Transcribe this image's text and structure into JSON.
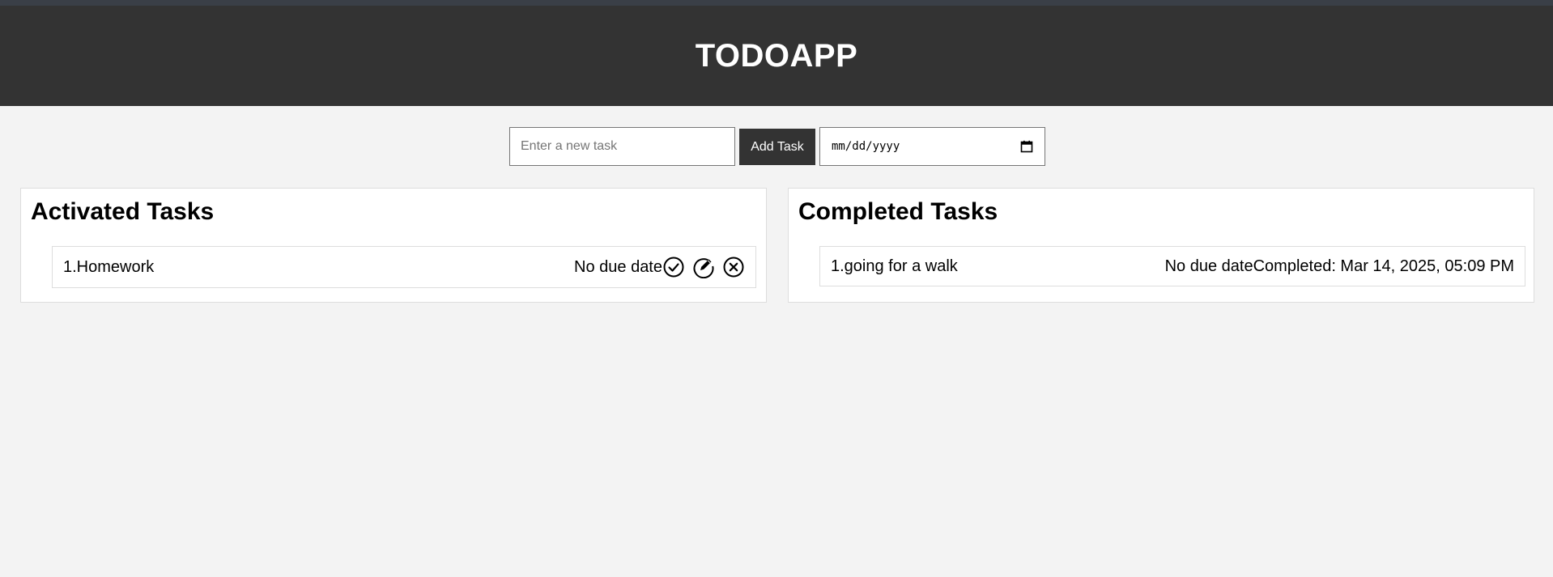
{
  "header": {
    "title": "TODOAPP"
  },
  "form": {
    "task_placeholder": "Enter a new task",
    "add_button_label": "Add Task",
    "date_placeholder": "mm/dd/yyyy"
  },
  "active": {
    "title": "Activated Tasks",
    "tasks": [
      {
        "label": "1.Homework",
        "due": "No due date"
      }
    ]
  },
  "completed": {
    "title": "Completed Tasks",
    "tasks": [
      {
        "label": "1.going for a walk",
        "due": "No due date",
        "completed": "Completed: Mar 14, 2025, 05:09 PM"
      }
    ]
  },
  "icons": [
    "calendar-icon",
    "check-circle-icon",
    "edit-icon",
    "close-circle-icon"
  ]
}
